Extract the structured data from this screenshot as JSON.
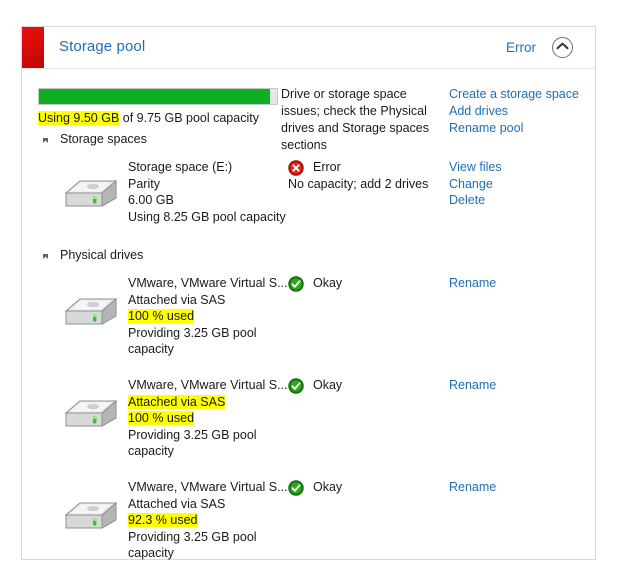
{
  "header": {
    "title": "Storage pool",
    "status": "Error",
    "collapse_icon": "chevron-up-icon",
    "accent_color": "#dc0c0b"
  },
  "summary": {
    "bar": {
      "used_gb": 9.5,
      "total_gb": 9.75,
      "percent": 97,
      "fill_color": "#0faf25"
    },
    "capacity_text_highlighted": "Using 9.50 GB",
    "capacity_text_rest": " of 9.75 GB pool capacity",
    "issue_message": "Drive or storage space issues; check the Physical drives and Storage spaces sections",
    "actions": [
      "Create a storage space",
      "Add drives",
      "Rename pool"
    ]
  },
  "sections": [
    {
      "label": "Storage spaces",
      "expanded": true,
      "items": [
        {
          "icon": "disk-drive-icon",
          "name": "Storage space (E:)",
          "resiliency": "Parity",
          "size": "6.00 GB",
          "pool_usage": "Using 8.25 GB pool capacity",
          "status": "Error",
          "status_icon": "error-icon",
          "status_detail": "No capacity; add 2 drives",
          "links": [
            "View files",
            "Change",
            "Delete"
          ]
        }
      ]
    },
    {
      "label": "Physical drives",
      "expanded": true,
      "items": [
        {
          "icon": "disk-drive-icon",
          "name": "VMware, VMware Virtual S...",
          "attached": "Attached via SAS",
          "attached_highlighted": false,
          "used": "100 % used",
          "used_highlighted": true,
          "providing": "Providing 3.25 GB pool capacity",
          "status": "Okay",
          "status_icon": "okay-icon",
          "links": [
            "Rename"
          ]
        },
        {
          "icon": "disk-drive-icon",
          "name": "VMware, VMware Virtual S...",
          "attached": "Attached via SAS",
          "attached_highlighted": true,
          "used": "100 % used",
          "used_highlighted": true,
          "providing": "Providing 3.25 GB pool capacity",
          "status": "Okay",
          "status_icon": "okay-icon",
          "links": [
            "Rename"
          ]
        },
        {
          "icon": "disk-drive-icon",
          "name": "VMware, VMware Virtual S...",
          "attached": "Attached via SAS",
          "attached_highlighted": false,
          "used": "92.3 % used",
          "used_highlighted": true,
          "providing": "Providing 3.25 GB pool capacity",
          "status": "Okay",
          "status_icon": "okay-icon",
          "links": [
            "Rename"
          ]
        }
      ]
    }
  ],
  "colors": {
    "link": "#1f6fb5",
    "highlight": "#ffff00",
    "error": "#d01a12",
    "okay": "#2f9e1f"
  }
}
